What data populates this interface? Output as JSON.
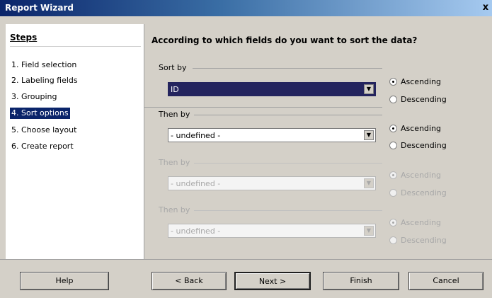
{
  "window": {
    "title": "Report Wizard",
    "close_label": "x"
  },
  "sidebar": {
    "header": "Steps",
    "items": [
      {
        "label": "1. Field selection"
      },
      {
        "label": "2. Labeling fields"
      },
      {
        "label": "3. Grouping"
      },
      {
        "label": "4. Sort options"
      },
      {
        "label": "5. Choose layout"
      },
      {
        "label": "6. Create report"
      }
    ],
    "selected_index": 3
  },
  "main": {
    "heading": "According to which fields do you want to sort the data?",
    "groups": [
      {
        "label": "Sort by",
        "value": "ID",
        "enabled": true,
        "order": "Ascending"
      },
      {
        "label": "Then by",
        "value": "- undefined -",
        "enabled": true,
        "order": "Ascending"
      },
      {
        "label": "Then by",
        "value": "- undefined -",
        "enabled": false,
        "order": "Ascending"
      },
      {
        "label": "Then by",
        "value": "- undefined -",
        "enabled": false,
        "order": "Ascending"
      }
    ],
    "ascending_label": "Ascending",
    "descending_label": "Descending"
  },
  "footer": {
    "help": "Help",
    "back": "< Back",
    "next": "Next >",
    "finish": "Finish",
    "cancel": "Cancel"
  },
  "colors": {
    "selection": "#0a246a",
    "titlebar_start": "#0a246a",
    "titlebar_end": "#a6caf0"
  }
}
